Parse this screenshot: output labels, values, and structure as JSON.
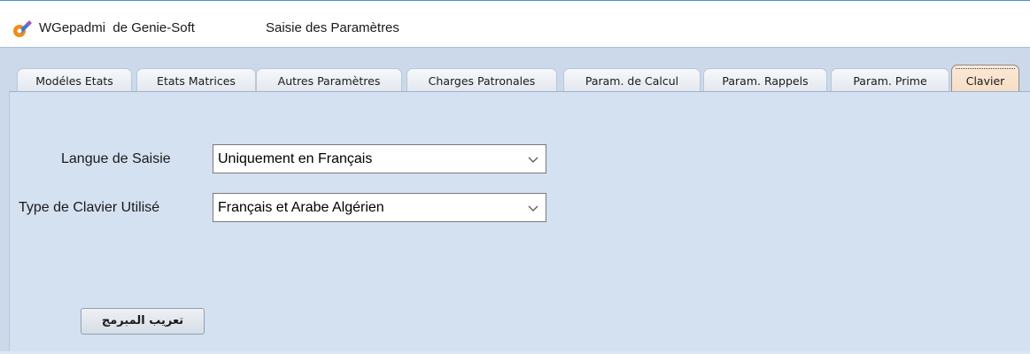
{
  "app": {
    "name": "WGepadmi  de Genie-Soft",
    "window_title": "Saisie des Paramètres",
    "icon": "app-logo-icon"
  },
  "tabs": [
    {
      "label": "Modéles Etats",
      "active": false
    },
    {
      "label": "Etats Matrices",
      "active": false
    },
    {
      "label": "Autres Paramètres",
      "active": false
    },
    {
      "label": "Charges Patronales",
      "active": false
    },
    {
      "label": "Param. de Calcul",
      "active": false
    },
    {
      "label": "Param. Rappels",
      "active": false
    },
    {
      "label": "Param.  Prime",
      "active": false
    },
    {
      "label": "Clavier",
      "active": true
    }
  ],
  "form": {
    "langue": {
      "label": "Langue de Saisie",
      "value": "Uniquement en Français",
      "icon": "chevron-down-icon"
    },
    "clavier": {
      "label": "Type de Clavier Utilisé",
      "value": "Français et Arabe Algérien",
      "icon": "chevron-down-icon"
    }
  },
  "button": {
    "label": "تعريب المبرمج"
  },
  "colors": {
    "frame": "#cbd9ea",
    "panel": "#d4e1f1",
    "active_tab": "#f6ddc4",
    "accent_line": "#4a90d9"
  }
}
